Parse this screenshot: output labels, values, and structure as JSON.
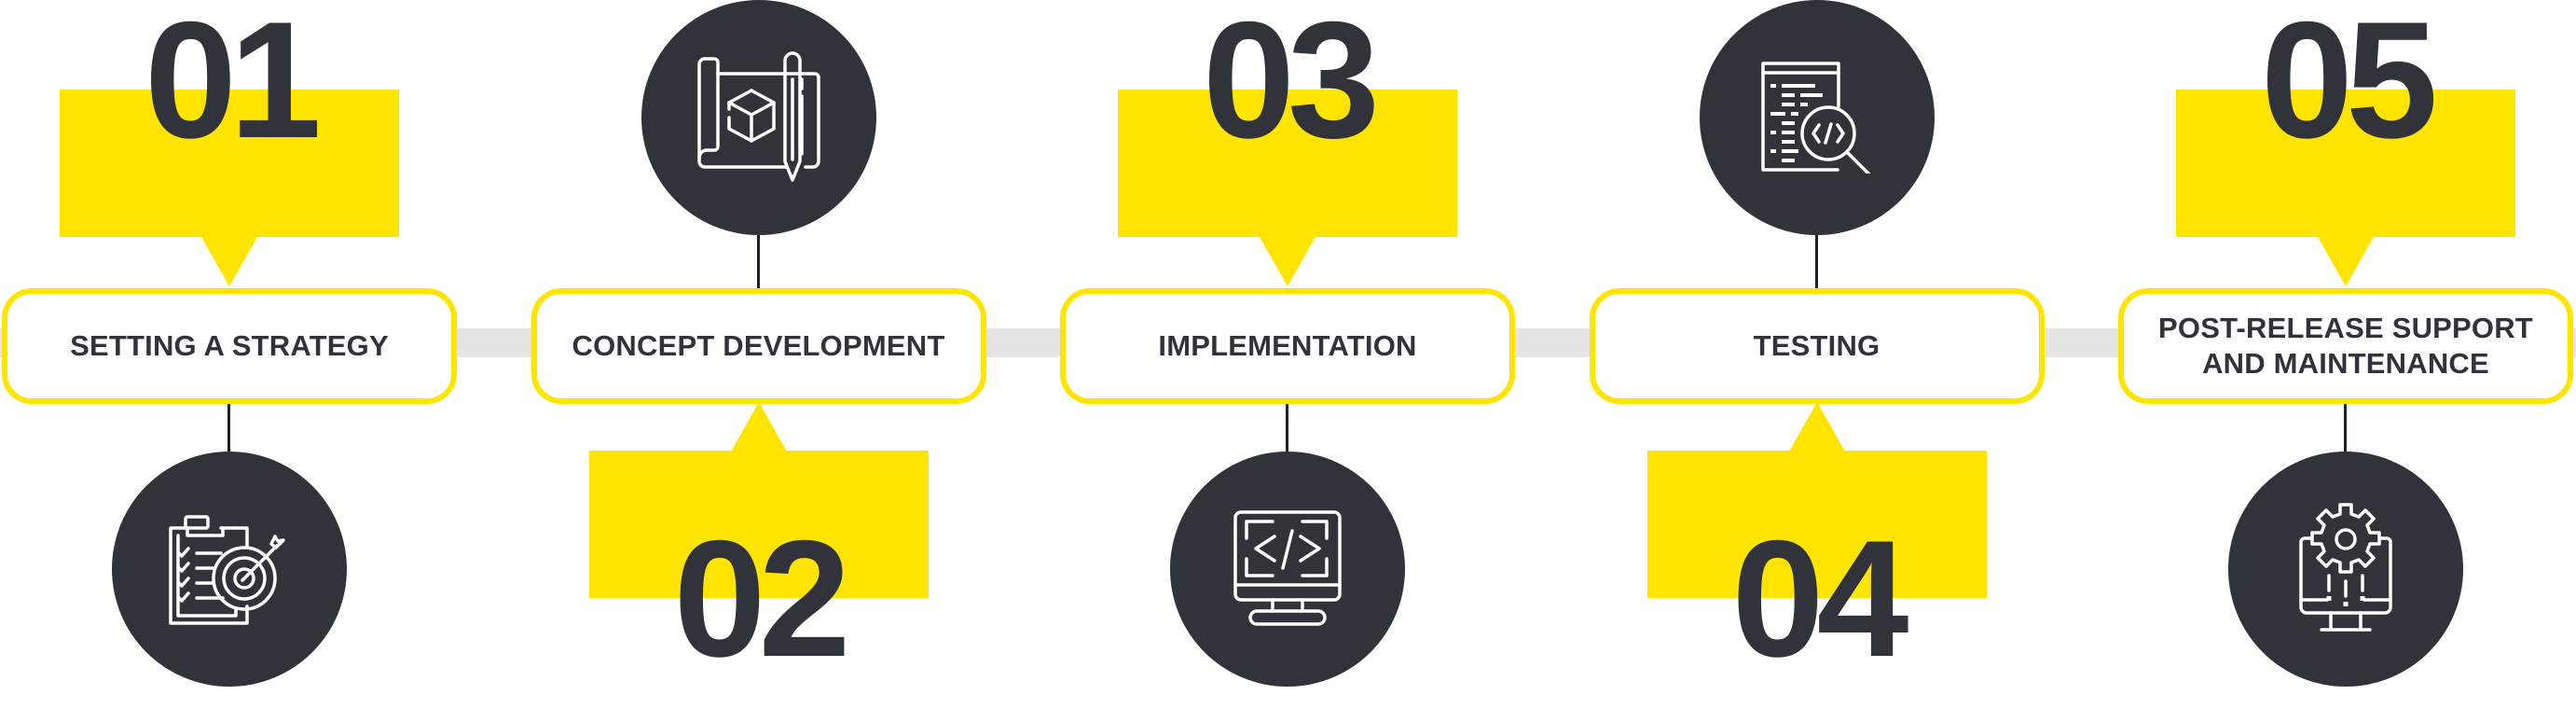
{
  "colors": {
    "accent": "#FFE400",
    "dark": "#30343A",
    "track": "#E5E5E5",
    "background": "#FFFFFF"
  },
  "steps": [
    {
      "number": "01",
      "label": "SETTING A STRATEGY",
      "icon": "clipboard-target-icon",
      "callout_position": "top",
      "icon_position": "bottom"
    },
    {
      "number": "02",
      "label": "CONCEPT DEVELOPMENT",
      "icon": "blueprint-pencil-cube-icon",
      "callout_position": "bottom",
      "icon_position": "top"
    },
    {
      "number": "03",
      "label": "IMPLEMENTATION",
      "icon": "monitor-code-icon",
      "callout_position": "top",
      "icon_position": "bottom"
    },
    {
      "number": "04",
      "label": "TESTING",
      "icon": "code-document-magnifier-icon",
      "callout_position": "bottom",
      "icon_position": "top"
    },
    {
      "number": "05",
      "label": "POST-RELEASE SUPPORT AND MAINTENANCE",
      "icon": "monitor-gear-icon",
      "callout_position": "top",
      "icon_position": "bottom"
    }
  ]
}
